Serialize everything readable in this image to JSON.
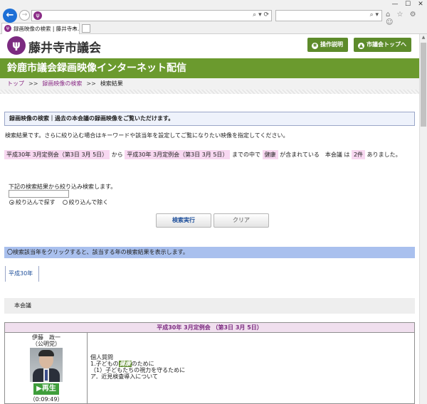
{
  "browser": {
    "tab_title": "録画映像の検索 | 藤井寺市...",
    "tab_close": "×",
    "nav_back": "←",
    "nav_forward": "→",
    "address_buttons": "⌕ ▾ ⟳",
    "search_icon": "⌕ ▾",
    "window_controls": [
      "—",
      "☐",
      "✕"
    ],
    "tool_icons": "⌂ ☆ ⚙ ☺"
  },
  "header": {
    "logo_text": "藤井寺市議会",
    "help_button": "操作説明",
    "top_button": "市議会トップへ"
  },
  "title_bar": "鈴鹿市議会録画映像インターネット配信",
  "breadcrumb": {
    "top": "トップ",
    "sep": ">>",
    "search": "録画映像の検索",
    "current": "検索結果"
  },
  "notice": "録画映像の検索｜過去の本会議の録画映像をご覧いただけます。",
  "description": "検索結果です。さらに絞り込む場合はキーワードや該当年を設定してご覧になりたい映像を指定してください。",
  "conditions": {
    "from_session": "平成30年 3月定例会（第3日 3月 5日）",
    "from_word": "から",
    "to_session": "平成30年 3月定例会（第3日 3月 5日）",
    "to_word": "までの中で",
    "keyword": "健康",
    "contains_word": "が含まれている　本会議 は",
    "count": "2件",
    "tail": "ありました。"
  },
  "narrow": {
    "label": "下記の検索結果から絞り込み検索します。",
    "input_value": "",
    "option_include": "絞り込んで探す",
    "option_exclude": "絞り込んで除く"
  },
  "buttons": {
    "search": "検索実行",
    "clear": "クリア"
  },
  "info_bar": "〇検索該当年をクリックすると、該当する年の検索結果を表示します。",
  "year_tab": "平成30年",
  "meeting_type": "本会議",
  "result": {
    "session_header": "平成30年 3月定例会 （第3日 3月 5日）",
    "speaker": "伊藤　政一",
    "party": "（公明党）",
    "play_label": "再生",
    "play_icon": "▶",
    "duration": "（0:09:49）",
    "question_type": "個人質問",
    "item1_prefix": "1.子どもの",
    "item1_keyword": "健康",
    "item1_suffix": "のために",
    "item2": "（1）子どもたちの視力を守るために",
    "item3": "ア．近見検査導入について"
  }
}
